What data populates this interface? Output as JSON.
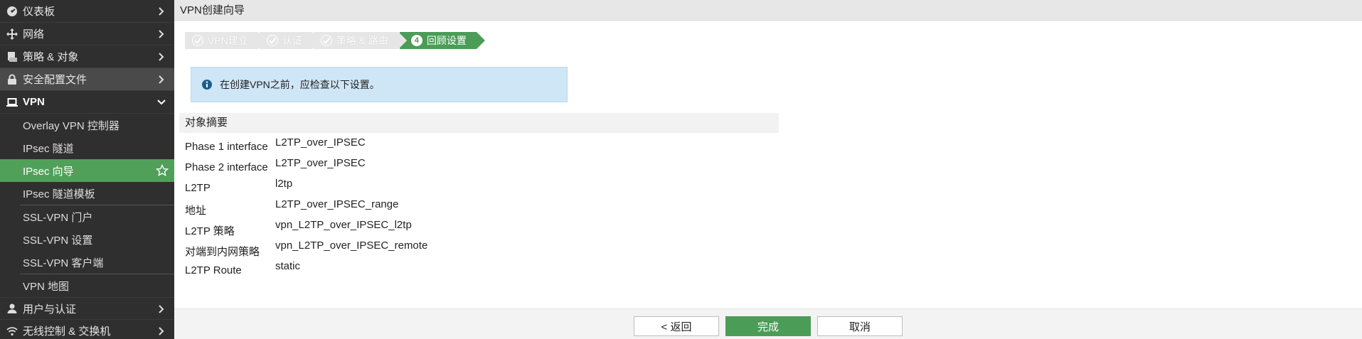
{
  "sidebar": {
    "items": [
      {
        "label": "仪表板",
        "icon": "dashboard-icon"
      },
      {
        "label": "网络",
        "icon": "network-icon"
      },
      {
        "label": "策略 & 对象",
        "icon": "policy-icon"
      },
      {
        "label": "安全配置文件",
        "icon": "lock-icon"
      },
      {
        "label": "VPN",
        "icon": "laptop-icon"
      },
      {
        "label": "用户与认证",
        "icon": "user-icon"
      },
      {
        "label": "无线控制 & 交换机",
        "icon": "wifi-icon"
      }
    ],
    "vpn_sub_items": [
      {
        "label": "Overlay VPN 控制器"
      },
      {
        "label": "IPsec 隧道"
      },
      {
        "label": "IPsec 向导"
      },
      {
        "label": "IPsec 隧道模板"
      },
      {
        "label": "SSL-VPN 门户"
      },
      {
        "label": "SSL-VPN 设置"
      },
      {
        "label": "SSL-VPN 客户端"
      },
      {
        "label": "VPN 地图"
      }
    ]
  },
  "header": {
    "title": "VPN创建向导"
  },
  "steps": [
    {
      "label": "VPN建立",
      "state": "done"
    },
    {
      "label": "认证",
      "state": "done"
    },
    {
      "label": "策略 & 路由",
      "state": "done"
    },
    {
      "number": "4",
      "label": "回顾设置",
      "state": "current"
    }
  ],
  "info": {
    "message": "在创建VPN之前，应检查以下设置。"
  },
  "summary": {
    "title": "对象摘要",
    "rows": [
      {
        "key": "Phase 1 interface",
        "value": "L2TP_over_IPSEC"
      },
      {
        "key": "Phase 2 interface",
        "value": "L2TP_over_IPSEC"
      },
      {
        "key": "L2TP",
        "value": "l2tp"
      },
      {
        "key": "地址",
        "value": "L2TP_over_IPSEC_range"
      },
      {
        "key": "L2TP 策略",
        "value": "vpn_L2TP_over_IPSEC_l2tp"
      },
      {
        "key": "对端到内网策略",
        "value": "vpn_L2TP_over_IPSEC_remote"
      },
      {
        "key": "L2TP Route",
        "value": "static"
      }
    ]
  },
  "footer": {
    "back_label": "< 返回",
    "finish_label": "完成",
    "cancel_label": "取消"
  },
  "colors": {
    "accent": "#4b9c57",
    "sidebar_bg": "#2f2f2f",
    "info_bg": "#cfe6f7"
  }
}
